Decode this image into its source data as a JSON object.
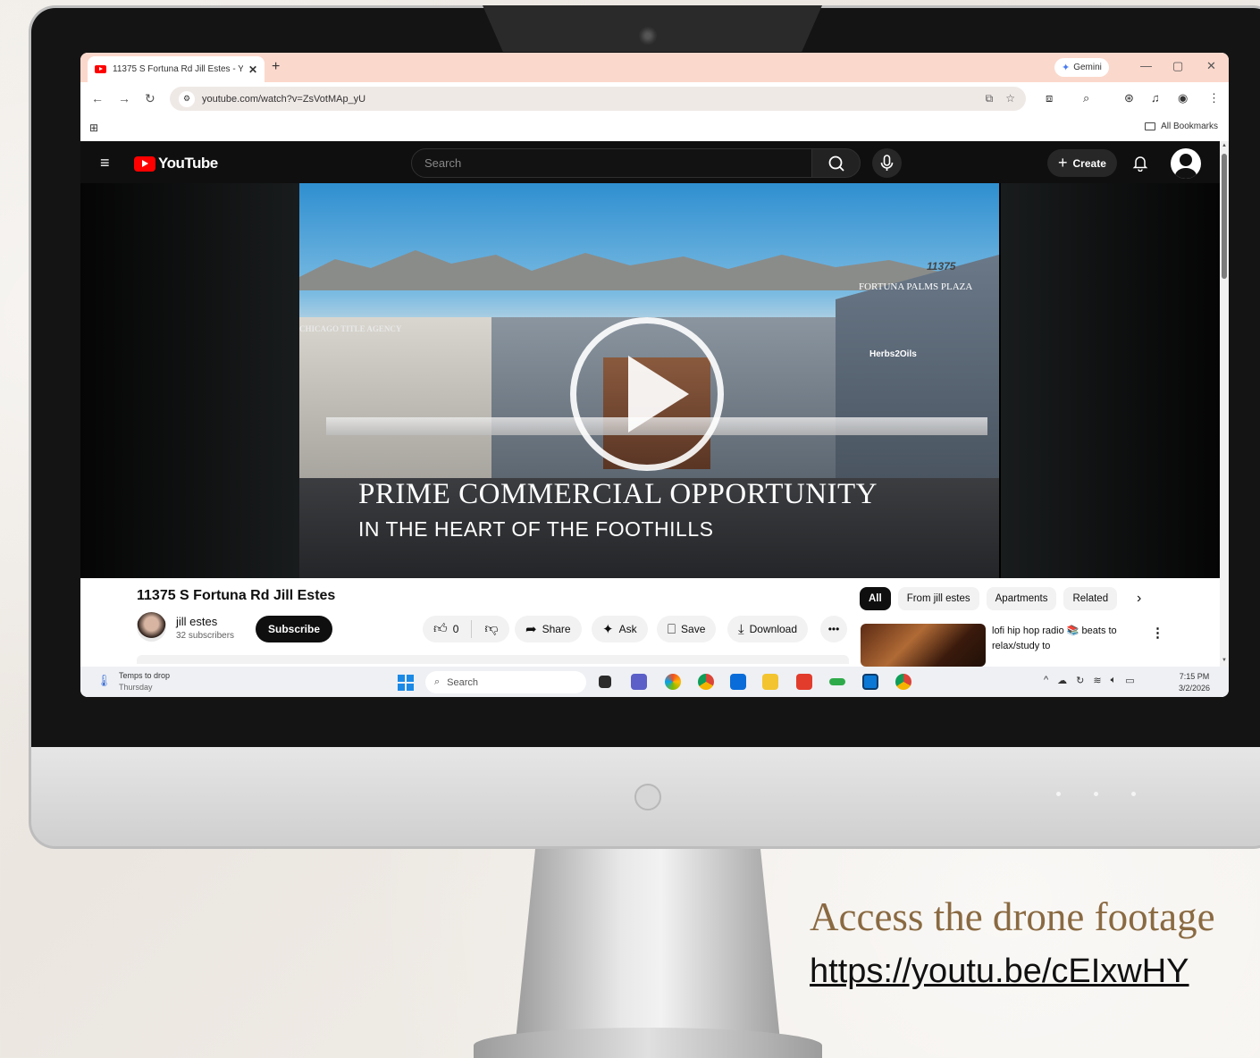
{
  "browser": {
    "tab_title": "11375 S Fortuna Rd Jill Estes - YouTube",
    "new_tab": "+",
    "gemini_label": "Gemini",
    "url": "youtube.com/watch?v=ZsVotMAp_yU",
    "all_bookmarks": "All Bookmarks"
  },
  "youtube": {
    "logo_text": "YouTube",
    "search_placeholder": "Search",
    "create_label": "Create",
    "video_overlay_line1": "PRIME COMMERCIAL OPPORTUNITY",
    "video_overlay_line2": "IN THE HEART OF THE FOOTHILLS",
    "sign_number": "11375",
    "sign_name": "FORTUNA PALMS PLAZA",
    "sign_agency": "CHICAGO TITLE AGENCY",
    "sign_herbs": "Herbs2Oils",
    "video_title": "11375 S Fortuna Rd Jill Estes",
    "channel_name": "jill estes",
    "channel_subs": "32 subscribers",
    "subscribe_label": "Subscribe",
    "like_count": "0",
    "share_label": "Share",
    "ask_label": "Ask",
    "save_label": "Save",
    "download_label": "Download",
    "chips": [
      "All",
      "From jill estes",
      "Apartments",
      "Related"
    ],
    "rec_title": "lofi hip hop radio 📚 beats to relax/study to"
  },
  "taskbar": {
    "weather_title": "Temps to drop",
    "weather_sub": "Thursday",
    "search_label": "Search",
    "time": "7:15 PM",
    "date": "3/2/2026"
  },
  "caption": {
    "text": "Access the drone footage",
    "link": "https://youtu.be/cEIxwHY"
  }
}
